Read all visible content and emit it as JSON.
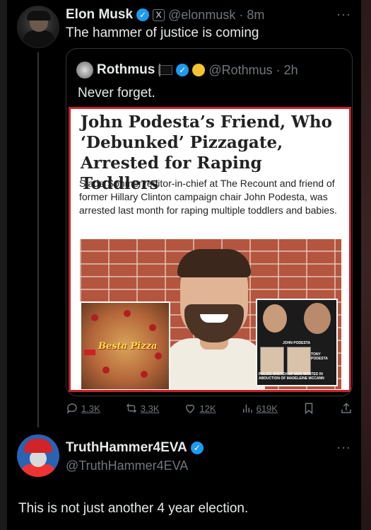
{
  "post": {
    "author_name": "Elon Musk",
    "x_badge": "X",
    "handle": "@elonmusk",
    "sep": "·",
    "time": "8m",
    "text": "The hammer of justice is coming",
    "more": "···"
  },
  "quote": {
    "author_name": "Rothmus",
    "handle": "@Rothmus",
    "sep": "·",
    "time": "2h",
    "text": "Never forget.",
    "article": {
      "headline": "John Podesta’s Friend, Who ‘Debunked’ Pizzagate, Arrested for Raping Toddlers",
      "subtext": "Slade Sohmer, editor-in-chief at The Recount and friend of former Hillary Clinton campaign chair John Podesta, was arrested last month for raping multiple toddlers and babies.",
      "pizza_label": "Besta Pizza",
      "inset_label_1": "JOHN PODESTA",
      "inset_label_2": "TONY PODESTA",
      "inset_caption": "POLICE SKETCH OF MEN WANTED IN ABDUCTION OF MADELEINE MCCANN"
    }
  },
  "actions": {
    "replies": "1.3K",
    "reposts": "3.3K",
    "likes": "12K",
    "views": "619K"
  },
  "reply": {
    "author_name": "TruthHammer4EVA",
    "handle": "@TruthHammer4EVA",
    "more": "···",
    "text": "This is not just another 4 year election."
  },
  "colors": {
    "background": "#000000",
    "text": "#e7e9ea",
    "muted": "#71767b",
    "verified_blue": "#1d9bf0",
    "article_border": "#c8222c"
  }
}
